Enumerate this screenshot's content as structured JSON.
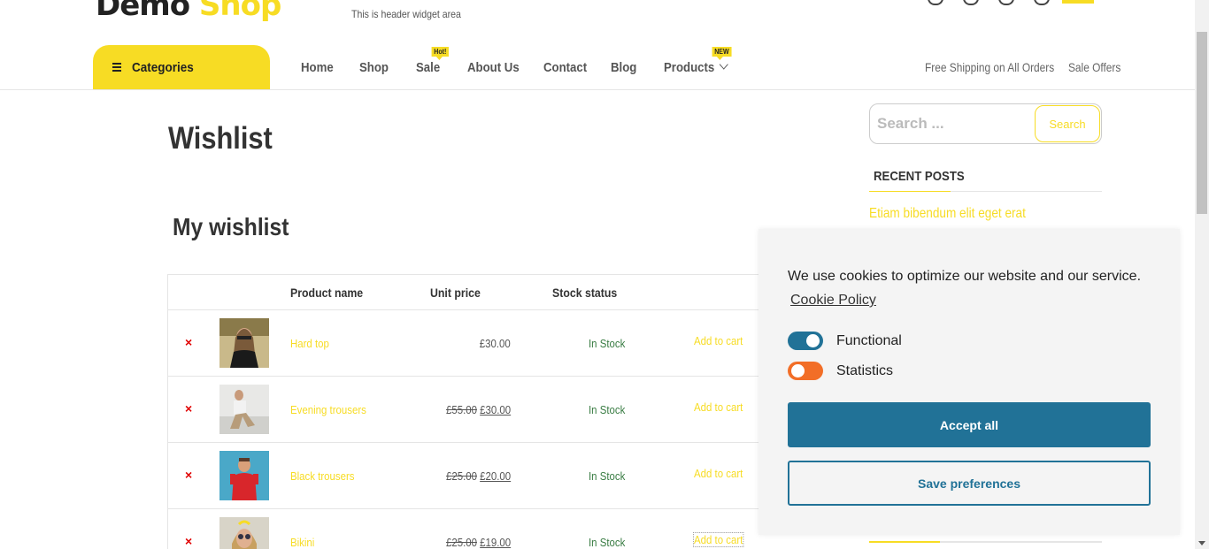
{
  "header": {
    "logo_part1": "Demo",
    "logo_part2": "Shop",
    "widget_text": "This is header widget area",
    "icons": [
      "whatsapp-icon",
      "location-icon",
      "user-icon",
      "cart-icon"
    ]
  },
  "nav": {
    "categories_label": "Categories",
    "items": [
      {
        "label": "Home"
      },
      {
        "label": "Shop"
      },
      {
        "label": "Sale",
        "tag": "Hot!"
      },
      {
        "label": "About Us"
      },
      {
        "label": "Contact"
      },
      {
        "label": "Blog"
      },
      {
        "label": "Products",
        "tag": "NEW"
      }
    ],
    "right_links": [
      "Free Shipping on All Orders",
      "Sale Offers"
    ]
  },
  "main": {
    "page_title": "Wishlist",
    "section_title": "My wishlist",
    "columns": [
      "Product name",
      "Unit price",
      "Stock status"
    ],
    "rows": [
      {
        "name": "Hard top",
        "old_price": "",
        "price": "£30.00",
        "stock": "In Stock",
        "action": "Add to cart",
        "thumb": "hard-top"
      },
      {
        "name": "Evening trousers",
        "old_price": "£55.00",
        "price": "£30.00",
        "stock": "In Stock",
        "action": "Add to cart",
        "thumb": "evening-trousers"
      },
      {
        "name": "Black trousers",
        "old_price": "£25.00",
        "price": "£20.00",
        "stock": "In Stock",
        "action": "Add to cart",
        "thumb": "black-trousers"
      },
      {
        "name": "Bikini",
        "old_price": "£25.00",
        "price": "£19.00",
        "stock": "In Stock",
        "action": "Add to cart",
        "thumb": "bikini"
      }
    ],
    "remove_symbol": "×"
  },
  "sidebar": {
    "search_placeholder": "Search ...",
    "search_button": "Search",
    "recent_posts_title": "RECENT POSTS",
    "recent_posts": [
      "Etiam bibendum elit eget erat"
    ]
  },
  "cookie": {
    "message": "We use cookies to optimize our website and our service.",
    "policy_link": "Cookie Policy",
    "toggles": [
      {
        "label": "Functional",
        "on": true
      },
      {
        "label": "Statistics",
        "on": false
      }
    ],
    "accept_label": "Accept all",
    "save_label": "Save preferences"
  },
  "colors": {
    "accent": "#f7dc24",
    "cookie_primary": "#217297",
    "toggle_off": "#f26e27",
    "in_stock": "#3a7d44",
    "remove": "#e00000"
  }
}
